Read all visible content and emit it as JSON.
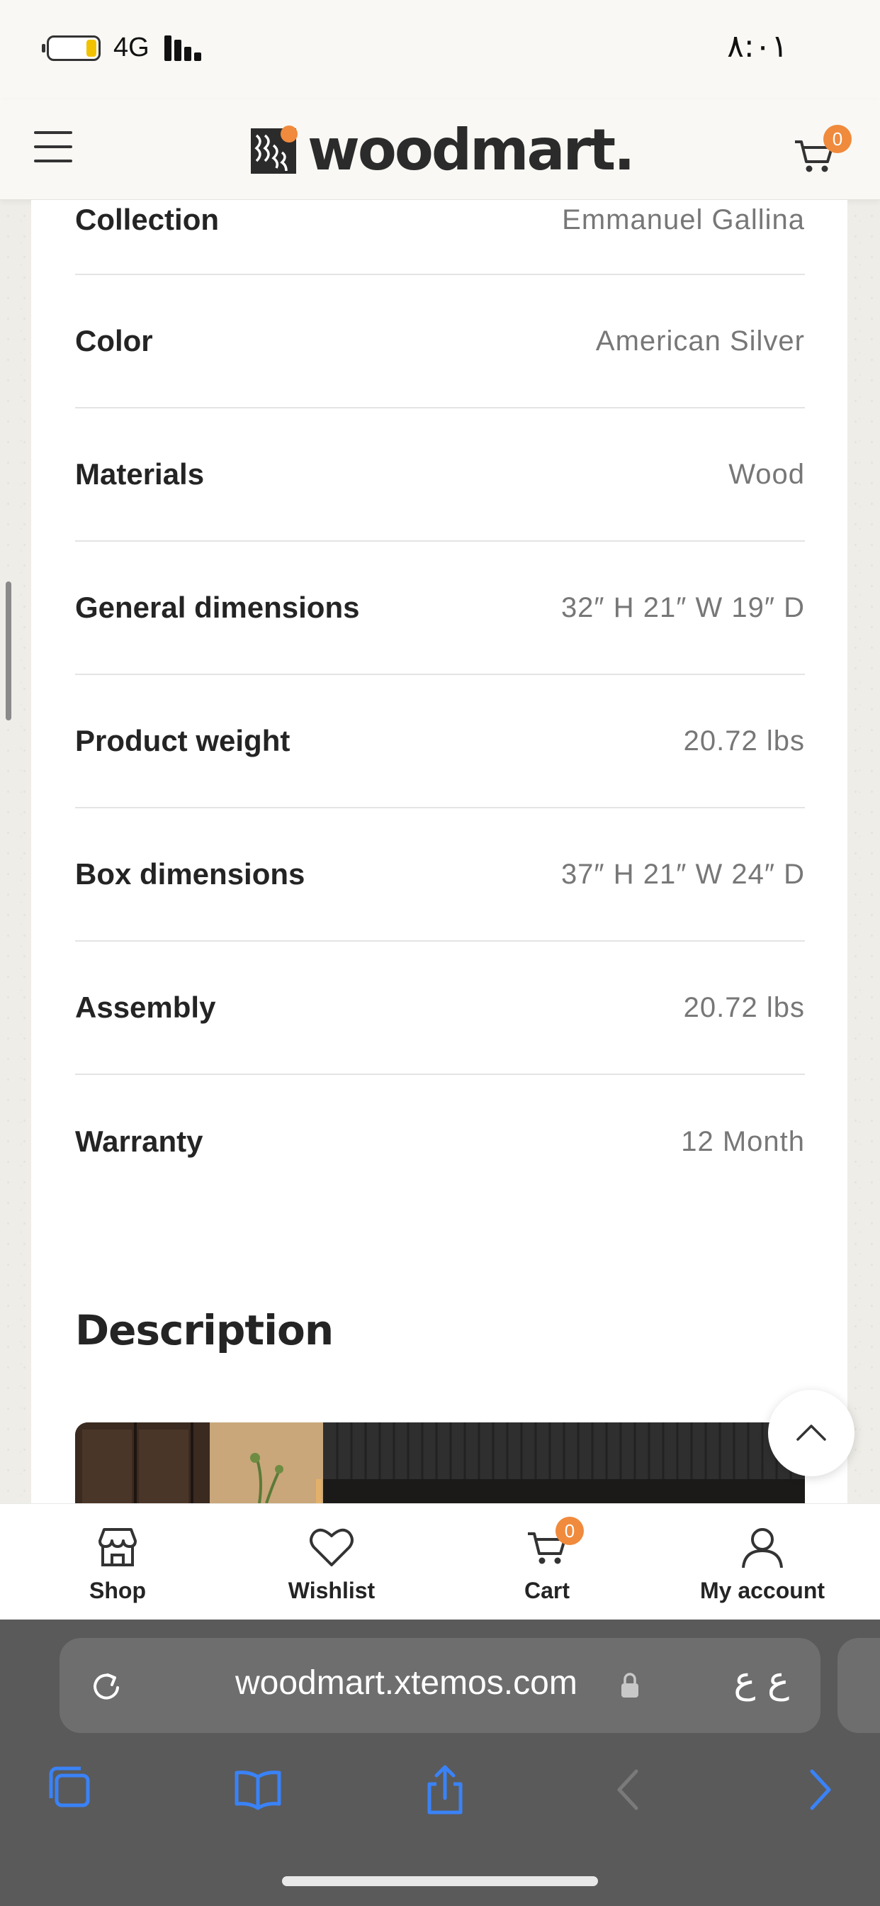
{
  "status_bar": {
    "network": "4G",
    "time": "٨:٠١"
  },
  "header": {
    "logo_text": "woodmart.",
    "cart_count": "0"
  },
  "specs": [
    {
      "label": "Collection",
      "value": "Emmanuel Gallina"
    },
    {
      "label": "Color",
      "value": "American Silver"
    },
    {
      "label": "Materials",
      "value": "Wood"
    },
    {
      "label": "General dimensions",
      "value": "32″ H 21″ W 19″ D"
    },
    {
      "label": "Product weight",
      "value": "20.72 lbs"
    },
    {
      "label": "Box dimensions",
      "value": "37″ H 21″ W 24″ D"
    },
    {
      "label": "Assembly",
      "value": "20.72 lbs"
    },
    {
      "label": "Warranty",
      "value": "12 Month"
    }
  ],
  "description": {
    "title": "Description"
  },
  "bottom_nav": {
    "items": [
      {
        "label": "Shop",
        "icon": "shop-icon"
      },
      {
        "label": "Wishlist",
        "icon": "heart-icon"
      },
      {
        "label": "Cart",
        "icon": "cart-icon",
        "badge": "0"
      },
      {
        "label": "My account",
        "icon": "user-icon"
      }
    ]
  },
  "browser": {
    "url": "woodmart.xtemos.com",
    "reader_label": "ع ع"
  },
  "colors": {
    "accent": "#f08a3c",
    "safari_blue": "#3a82f7"
  }
}
